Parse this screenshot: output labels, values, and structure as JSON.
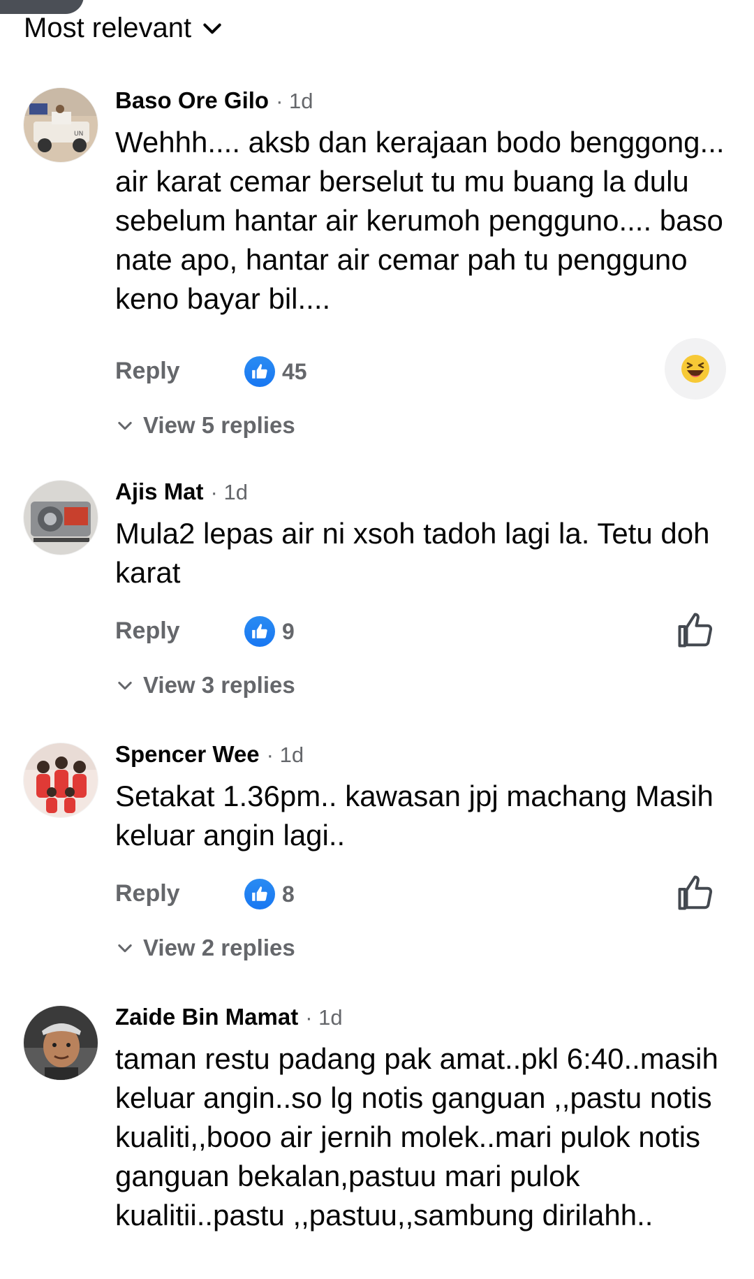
{
  "sort": {
    "label": "Most relevant",
    "icon": "chevron-down-icon"
  },
  "comments": [
    {
      "author": "Baso Ore Gilo",
      "time": "· 1d",
      "text": "Wehhh.... aksb dan kerajaan bodo benggong... air karat cemar berselut tu mu buang la dulu sebelum hantar air kerumoh pengguno.... baso nate apo, hantar air cemar pah tu pengguno keno bayar bil....",
      "reply_label": "Reply",
      "like_count": "45",
      "reaction_button": "haha-emoji",
      "view_replies": "View 5 replies"
    },
    {
      "author": "Ajis Mat",
      "time": "· 1d",
      "text": "Mula2 lepas air ni xsoh tadoh lagi la. Tetu doh karat",
      "reply_label": "Reply",
      "like_count": "9",
      "reaction_button": "like-outline",
      "view_replies": "View 3 replies"
    },
    {
      "author": "Spencer Wee",
      "time": "· 1d",
      "text": "Setakat 1.36pm.. kawasan jpj machang Masih keluar angin lagi..",
      "reply_label": "Reply",
      "like_count": "8",
      "reaction_button": "like-outline",
      "view_replies": "View 2 replies"
    },
    {
      "author": "Zaide Bin Mamat",
      "time": "· 1d",
      "text": "taman restu padang pak amat..pkl 6:40..masih keluar angin..so lg notis ganguan ,,pastu notis kualiti,,booo air jernih molek..mari pulok notis ganguan bekalan,pastuu mari pulok kualitii..pastu ,,pastuu,,sambung dirilahh..",
      "reply_label": "",
      "like_count": "",
      "reaction_button": "",
      "view_replies": ""
    }
  ],
  "colors": {
    "text_primary": "#050505",
    "text_secondary": "#65676b",
    "like_blue": "#1877f2",
    "react_bg": "#f2f2f3"
  }
}
